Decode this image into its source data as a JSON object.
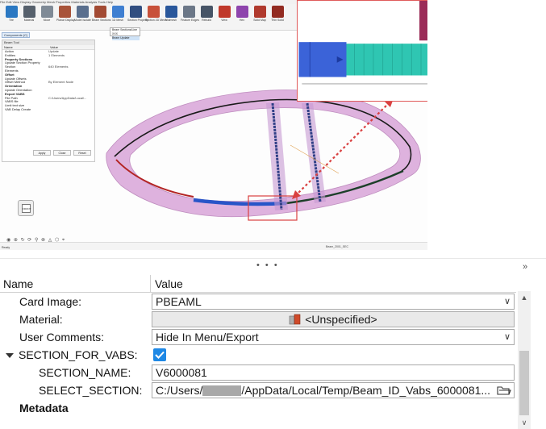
{
  "app": {
    "menu_text": "File Edit View Display Geometry Mesh Properties Materials Analysis Tools Help",
    "ribbon": [
      {
        "label": "Tire",
        "color": "#2b78c2"
      },
      {
        "label": "Material",
        "color": "#56606c"
      },
      {
        "label": "Move",
        "color": "#7f8a96"
      },
      {
        "label": "Planar Display",
        "color": "#a8543a"
      },
      {
        "label": "Model Isolate",
        "color": "#5a6f8e"
      },
      {
        "label": "Beam Sections",
        "color": "#a24a33"
      },
      {
        "label": "1D Mesh",
        "color": "#3f7fd1"
      },
      {
        "label": "Section Property",
        "color": "#314e80"
      },
      {
        "label": "Section 2D Mesh",
        "color": "#c8513a"
      },
      {
        "label": "Midmesh",
        "color": "#29579b"
      },
      {
        "label": "Feature Edges",
        "color": "#6b7787"
      },
      {
        "label": "Rebuild",
        "color": "#465466"
      },
      {
        "label": "View",
        "color": "#c0392b"
      },
      {
        "label": "Hex",
        "color": "#8e44ad"
      },
      {
        "label": "Solid Map",
        "color": "#b03a2e"
      },
      {
        "label": "Thin Solid",
        "color": "#922b21"
      }
    ],
    "ribbon_dropdown": [
      "Beam Sections/Line XXX",
      "Beam Update"
    ],
    "subbar_label": "Components (C)",
    "left_panel": {
      "title": "Beam Tool",
      "col_name": "Name",
      "col_value": "Value",
      "rows": [
        {
          "k": "Action",
          "v": "Update",
          "bold": false
        },
        {
          "k": "Entities",
          "v": "1 Elements",
          "bold": false
        },
        {
          "k": "Property Sections",
          "v": "",
          "bold": true
        },
        {
          "k": "Update Section Property",
          "v": "",
          "bold": false
        },
        {
          "k": "Section",
          "v": "640 Elements",
          "bold": false
        },
        {
          "k": "Elements",
          "v": "",
          "bold": false
        },
        {
          "k": "Offset",
          "v": "",
          "bold": true
        },
        {
          "k": "Update Offsets",
          "v": "",
          "bold": false
        },
        {
          "k": "Offset Method",
          "v": "By Element Node",
          "bold": false
        },
        {
          "k": "Orientation",
          "v": "",
          "bold": true
        },
        {
          "k": "Update Orientation",
          "v": "",
          "bold": false
        },
        {
          "k": "Export VABS",
          "v": "",
          "bold": true
        },
        {
          "k": "File Path",
          "v": "C:/Users/AppData/Local/...",
          "bold": false
        },
        {
          "k": "VABS file",
          "v": "",
          "bold": false
        },
        {
          "k": "Limit text size",
          "v": "",
          "bold": false
        },
        {
          "k": "VAB Delay Create",
          "v": "",
          "bold": false
        }
      ],
      "buttons": [
        "Apply",
        "Close",
        "Reset"
      ]
    },
    "nav_cube": "FRONT",
    "status_left": "Ready",
    "status_right": "Beam_2001_SEC",
    "bottom_tools": "◉ ⊕ ↻ ⟳ ⚲ ⊗ ◬ ⬡ ⌖"
  },
  "props": {
    "header_name": "Name",
    "header_value": "Value",
    "rows": [
      {
        "label": "Card Image:",
        "value": "PBEAML"
      },
      {
        "label": "Material:",
        "value": "<Unspecified>"
      },
      {
        "label": "User Comments:",
        "value": "Hide In Menu/Export"
      },
      {
        "label": "SECTION_FOR_VABS:",
        "value": ""
      },
      {
        "label": "SECTION_NAME:",
        "value": "V6000081"
      },
      {
        "label": "SELECT_SECTION:",
        "value_prefix": "C:/Users/",
        "value_suffix": "/AppData/Local/Temp/Beam_ID_Vabs_6000081..."
      },
      {
        "label": "Metadata",
        "value": ""
      }
    ]
  }
}
